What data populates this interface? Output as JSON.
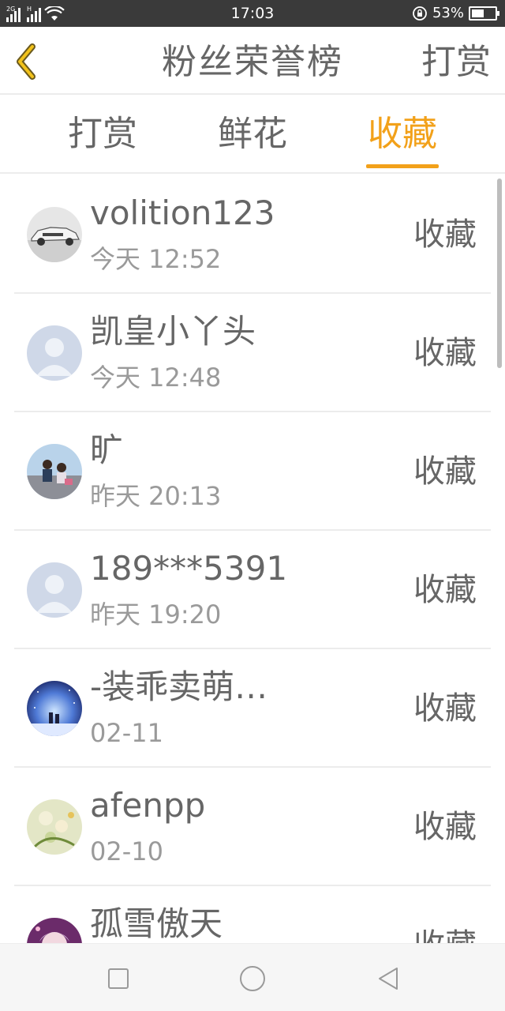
{
  "status_bar": {
    "network_1": "2G",
    "network_2": "H",
    "time": "17:03",
    "battery": "53%",
    "battery_level": 0.53,
    "icons": [
      "signal-icon",
      "signal-icon",
      "wifi-icon",
      "rotation-lock-icon",
      "battery-icon"
    ]
  },
  "header": {
    "title": "粉丝荣誉榜",
    "action_label": "打赏",
    "back_icon": "chevron-left-icon"
  },
  "tabs": [
    {
      "label": "打赏",
      "active": false
    },
    {
      "label": "鲜花",
      "active": false
    },
    {
      "label": "收藏",
      "active": true
    }
  ],
  "colors": {
    "accent": "#f2a11a",
    "text": "#666666",
    "subtext": "#9a9a9a",
    "divider": "#ececec",
    "status_bar": "#3a3a3a"
  },
  "fans": [
    {
      "name": "volition123",
      "time": "今天 12:52",
      "action": "收藏",
      "avatar": "car-photo-avatar"
    },
    {
      "name": "凯皇小丫头",
      "time": "今天 12:48",
      "action": "收藏",
      "avatar": "default-avatar"
    },
    {
      "name": "旷",
      "time": "昨天 20:13",
      "action": "收藏",
      "avatar": "couple-photo-avatar"
    },
    {
      "name": "189***5391",
      "time": "昨天 19:20",
      "action": "收藏",
      "avatar": "default-avatar"
    },
    {
      "name": "-装乖卖萌…",
      "time": "02-11",
      "action": "收藏",
      "avatar": "night-sky-avatar"
    },
    {
      "name": "afenpp",
      "time": "02-10",
      "action": "收藏",
      "avatar": "flower-art-avatar"
    },
    {
      "name": "孤雪傲天",
      "time": "",
      "action": "收藏",
      "avatar": "anime-girl-avatar"
    }
  ],
  "nav_bar": {
    "icons": [
      "recent-apps-icon",
      "home-icon",
      "back-icon"
    ]
  }
}
